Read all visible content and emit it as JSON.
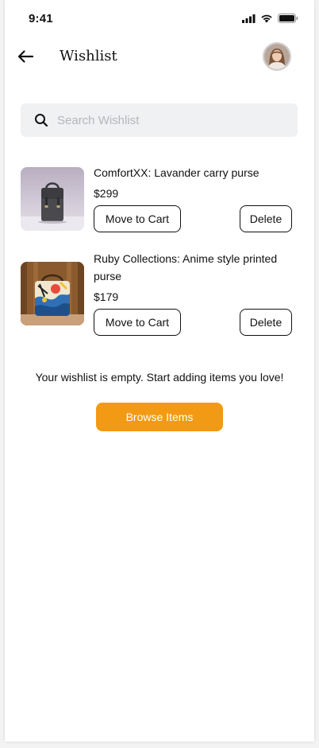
{
  "status_bar": {
    "time": "9:41"
  },
  "header": {
    "title": "Wishlist"
  },
  "search": {
    "placeholder": "Search Wishlist"
  },
  "items": [
    {
      "name": "ComfortXX:  Lavander carry purse",
      "price": "$299",
      "move_label": "Move to Cart",
      "delete_label": "Delete"
    },
    {
      "name": "Ruby Collections: Anime style printed purse",
      "price": "$179",
      "move_label": "Move to Cart",
      "delete_label": "Delete"
    }
  ],
  "empty_state": {
    "message": "Your wishlist is empty. Start adding items you love!",
    "button_label": "Browse Items"
  },
  "colors": {
    "accent": "#f29a13",
    "search_bg": "#f0f1f3"
  }
}
